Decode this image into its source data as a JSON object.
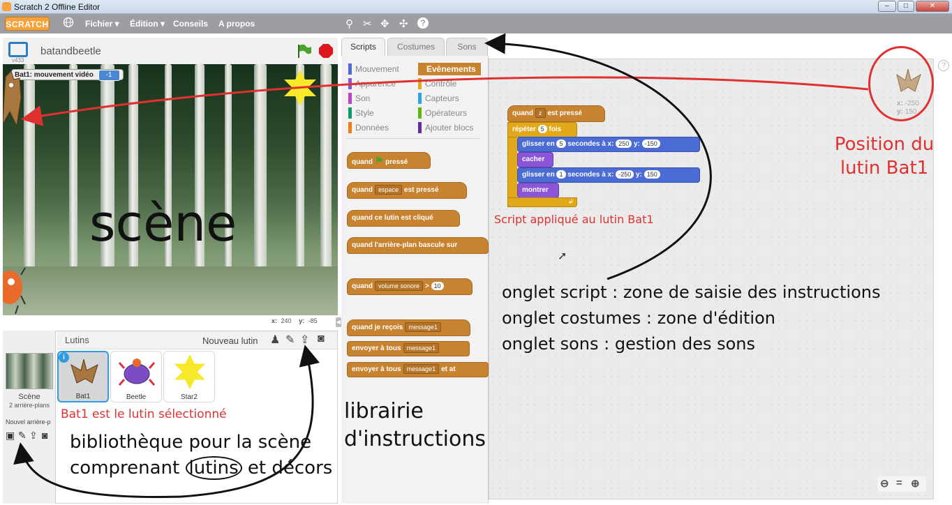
{
  "window": {
    "title": "Scratch 2 Offline Editor"
  },
  "menu": {
    "logo": "SCRATCH",
    "fichier": "Fichier ▾",
    "edition": "Édition ▾",
    "conseils": "Conseils",
    "apropos": "A propos"
  },
  "stage": {
    "project_name": "batandbeetle",
    "version": "v433",
    "video_label": "Bat1: mouvement vidéo",
    "video_value": "-1",
    "coords_x_label": "x:",
    "coords_x": "240",
    "coords_y_label": "y:",
    "coords_y": "-85"
  },
  "sprites_pane": {
    "title": "Lutins",
    "new_sprite": "Nouveau lutin",
    "scene_label": "Scène",
    "scene_sub": "2 arrière-plans",
    "new_backdrop": "Nouvel arrière-p",
    "sprites": [
      {
        "name": "Bat1"
      },
      {
        "name": "Beetle"
      },
      {
        "name": "Star2"
      }
    ]
  },
  "tabs": [
    "Scripts",
    "Costumes",
    "Sons"
  ],
  "categories": {
    "left": [
      {
        "label": "Mouvement",
        "color": "#4a6cd4"
      },
      {
        "label": "Apparence",
        "color": "#8a55d7"
      },
      {
        "label": "Son",
        "color": "#bb42c3"
      },
      {
        "label": "Style",
        "color": "#0e9a6c"
      },
      {
        "label": "Données",
        "color": "#ee7d16"
      }
    ],
    "right": [
      {
        "label": "Evènements",
        "color": "#c88330"
      },
      {
        "label": "Contrôle",
        "color": "#e1a91a"
      },
      {
        "label": "Capteurs",
        "color": "#2ca5e2"
      },
      {
        "label": "Opérateurs",
        "color": "#5cb712"
      },
      {
        "label": "Ajouter blocs",
        "color": "#632d99"
      }
    ]
  },
  "palette": {
    "b1_a": "quand",
    "b1_b": "pressé",
    "b2_a": "quand",
    "b2_dd": "espace",
    "b2_b": "est pressé",
    "b3": "quand ce lutin est cliqué",
    "b4": "quand l'arrière-plan bascule sur",
    "b5_a": "quand",
    "b5_dd": "volume sonore",
    "b5_op": ">",
    "b5_num": "10",
    "b6_a": "quand je reçois",
    "b6_dd": "message1",
    "b7_a": "envoyer à tous",
    "b7_dd": "message1",
    "b8_a": "envoyer à tous",
    "b8_dd": "message1",
    "b8_b": "et at"
  },
  "script": {
    "hat_a": "quand",
    "hat_dd": "z",
    "hat_b": "est pressé",
    "repeat_a": "répéter",
    "repeat_n": "5",
    "repeat_b": "fois",
    "g1_a": "glisser en",
    "g1_n": "5",
    "g1_b": "secondes à x:",
    "g1_x": "250",
    "g1_y_label": "y:",
    "g1_y": "-150",
    "hide": "cacher",
    "g2_a": "glisser en",
    "g2_n": "1",
    "g2_b": "secondes à x:",
    "g2_x": "-250",
    "g2_y_label": "y:",
    "g2_y": "150",
    "show": "montrer"
  },
  "sprite_info": {
    "x_label": "x:",
    "x": "-250",
    "y_label": "y:",
    "y": "150"
  },
  "annotations": {
    "scene": "scène",
    "script_applied": "Script appliqué au lutin Bat1",
    "position_1": "Position du",
    "position_2": "lutin Bat1",
    "onglet_script": "onglet script : zone de saisie des instructions",
    "onglet_costumes": "onglet costumes : zone d'édition",
    "onglet_sons": "onglet sons : gestion des sons",
    "librairie_1": "librairie",
    "librairie_2": "d'instructions",
    "selected": "Bat1 est le lutin sélectionné",
    "biblio_1": "bibliothèque pour la scène",
    "biblio_2a": "comprenant ",
    "biblio_2b": "lutins",
    "biblio_2c": " et décors"
  },
  "colors": {
    "accent": "#f7a23b",
    "annotation_red": "#e03131",
    "selection": "#2e9be0"
  }
}
